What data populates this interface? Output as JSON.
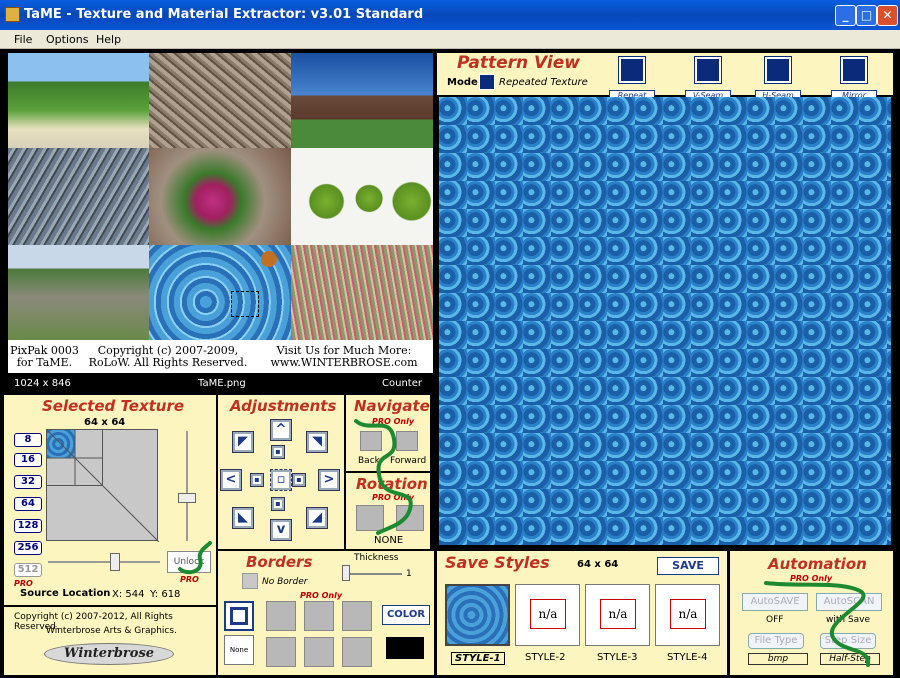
{
  "window": {
    "title": "TaME - Texture and Material Extractor:  v3.01 Standard"
  },
  "menu": [
    "File",
    "Options",
    "Help"
  ],
  "source": {
    "captions": [
      "PixPak 0003 for TaME.",
      "Copyright (c) 2007-2009, RoLoW. All Rights Reserved.",
      "Visit Us for Much More: www.WINTERBROSE.com"
    ],
    "dimensions": "1024 x 846",
    "filename": "TaME.png",
    "counter": "Counter"
  },
  "selected_texture": {
    "title": "Selected Texture",
    "size": "64 x 64",
    "sizes": [
      "8",
      "16",
      "32",
      "64",
      "128",
      "256",
      "512"
    ],
    "pro": "PRO",
    "unlock": "Unlock",
    "unlock_pro": "PRO",
    "source_location_label": "Source Location",
    "x": "X: 544",
    "y": "Y: 618"
  },
  "adjustments": {
    "title": "Adjustments"
  },
  "navigate": {
    "title": "Navigate",
    "pro": "PRO Only",
    "back": "Back",
    "forward": "Forward"
  },
  "rotation": {
    "title": "Rotation",
    "pro": "PRO Only",
    "value": "NONE"
  },
  "borders": {
    "title": "Borders",
    "thickness_label": "Thickness",
    "thickness": "1",
    "no_border": "No Border",
    "pro": "PRO Only",
    "none": "None",
    "color": "COLOR",
    "color_swatch": "#000000"
  },
  "pattern_view": {
    "title": "Pattern View",
    "mode_label": "Mode",
    "mode_value": "Repeated Texture",
    "buttons": [
      "Repeat",
      "V-Seam",
      "H-Seam",
      "Mirror"
    ]
  },
  "save_styles": {
    "title": "Save Styles",
    "size": "64 x 64",
    "save": "SAVE",
    "styles": [
      "STYLE-1",
      "STYLE-2",
      "STYLE-3",
      "STYLE-4"
    ],
    "na": "n/a"
  },
  "automation": {
    "title": "Automation",
    "pro": "PRO Only",
    "autosave": "AutoSAVE",
    "autosave_state": "OFF",
    "autoscan": "AutoSCAN",
    "with_save": "with Save",
    "file_type": "File Type",
    "file_type_value": "bmp",
    "step_size": "Step Size",
    "step_size_value": "Half-Step"
  },
  "footer": {
    "copyright": "Copyright (c) 2007-2012, All Rights Reserved.",
    "company": "Winterbrose Arts & Graphics.",
    "logo": "Winterbrose"
  },
  "colors": {
    "panel": "#fdf5c0",
    "title_red": "#c03020",
    "water": "#1f6fb0"
  }
}
